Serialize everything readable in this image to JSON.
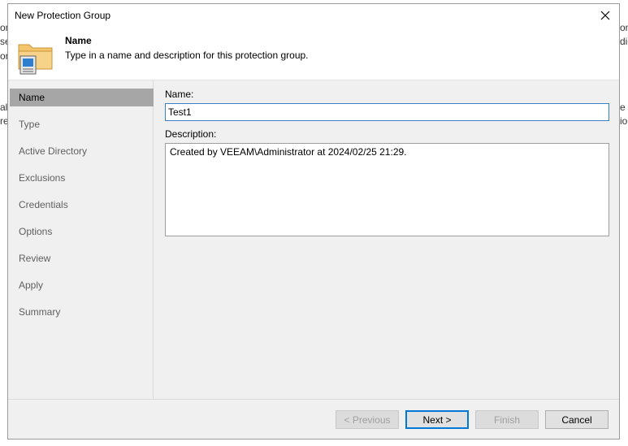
{
  "window": {
    "title": "New Protection Group",
    "close_label": "×"
  },
  "header": {
    "title": "Name",
    "subtitle": "Type in a name and description for this protection group.",
    "icon": "folder-computer-icon"
  },
  "steps": [
    {
      "label": "Name",
      "active": true
    },
    {
      "label": "Type"
    },
    {
      "label": "Active Directory"
    },
    {
      "label": "Exclusions"
    },
    {
      "label": "Credentials"
    },
    {
      "label": "Options"
    },
    {
      "label": "Review"
    },
    {
      "label": "Apply"
    },
    {
      "label": "Summary"
    }
  ],
  "form": {
    "name_label": "Name:",
    "name_value": "Test1",
    "description_label": "Description:",
    "description_value": "Created by VEEAM\\Administrator at 2024/02/25 21:29."
  },
  "buttons": {
    "previous": "< Previous",
    "next": "Next >",
    "finish": "Finish",
    "cancel": "Cancel"
  },
  "background_fragments": {
    "l1": "on",
    "l2": "se",
    "l3": "or",
    "l4": "al",
    "l5": "re",
    "r1": "om",
    "r2": "dic",
    "r3": "e",
    "r4": "io"
  },
  "colors": {
    "accent": "#0078d7",
    "active_step": "#a6a6a6",
    "dialog_bg": "#f0f0f0"
  }
}
